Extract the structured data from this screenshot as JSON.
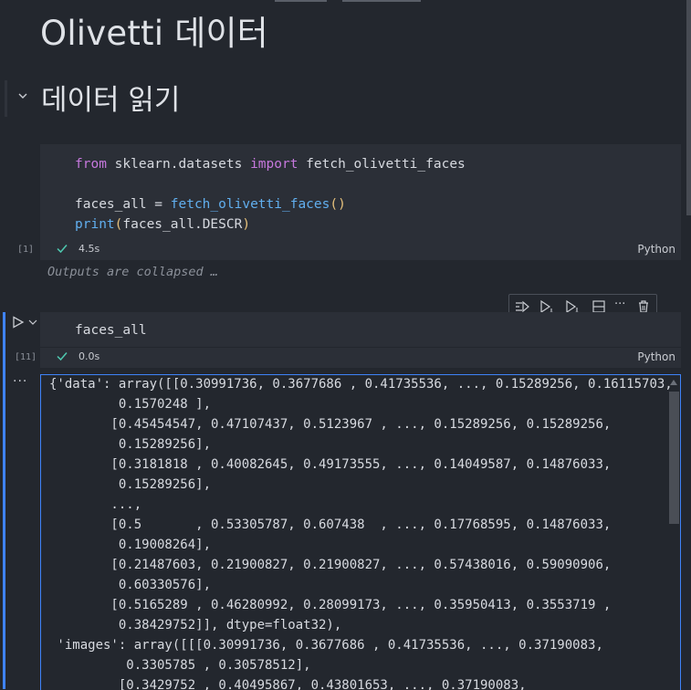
{
  "notebook": {
    "title": "Olivetti 데이터",
    "section_heading": "데이터 읽기"
  },
  "cell1": {
    "lines": [
      {
        "segments": [
          {
            "t": "from",
            "c": "kw"
          },
          {
            "t": " sklearn.datasets ",
            "c": ""
          },
          {
            "t": "import",
            "c": "kw"
          },
          {
            "t": " fetch_olivetti_faces",
            "c": ""
          }
        ]
      },
      {
        "segments": []
      },
      {
        "segments": [
          {
            "t": "faces_all = ",
            "c": ""
          },
          {
            "t": "fetch_olivetti_faces",
            "c": "fn"
          },
          {
            "t": "()",
            "c": "paren"
          }
        ]
      },
      {
        "segments": [
          {
            "t": "print",
            "c": "fn"
          },
          {
            "t": "(",
            "c": "paren"
          },
          {
            "t": "faces_all.DESCR",
            "c": ""
          },
          {
            "t": ")",
            "c": "paren"
          }
        ]
      }
    ],
    "exec_count": "[1]",
    "duration": "4.5s",
    "language": "Python",
    "collapsed_text": "Outputs are collapsed …"
  },
  "cell2": {
    "code": "faces_all",
    "exec_count": "[11]",
    "duration": "0.0s",
    "language": "Python",
    "more_label": "···"
  },
  "toolbar": {
    "more_label": "···"
  },
  "output": {
    "lines": [
      "{'data': array([[0.30991736, 0.3677686 , 0.41735536, ..., 0.15289256, 0.16115703,",
      "         0.1570248 ],",
      "        [0.45454547, 0.47107437, 0.5123967 , ..., 0.15289256, 0.15289256,",
      "         0.15289256],",
      "        [0.3181818 , 0.40082645, 0.49173555, ..., 0.14049587, 0.14876033,",
      "         0.15289256],",
      "        ...,",
      "        [0.5       , 0.53305787, 0.607438  , ..., 0.17768595, 0.14876033,",
      "         0.19008264],",
      "        [0.21487603, 0.21900827, 0.21900827, ..., 0.57438016, 0.59090906,",
      "         0.60330576],",
      "        [0.5165289 , 0.46280992, 0.28099173, ..., 0.35950413, 0.3553719 ,",
      "         0.38429752]], dtype=float32),",
      " 'images': array([[[0.30991736, 0.3677686 , 0.41735536, ..., 0.37190083,",
      "          0.3305785 , 0.30578512],",
      "         [0.3429752 , 0.40495867, 0.43801653, ..., 0.37190083,"
    ]
  },
  "colors": {
    "background": "#23272e",
    "cell_background": "#2b2f37",
    "accent": "#3f83f8",
    "keyword": "#c678dd",
    "function": "#61afef",
    "bracket": "#e5c07b",
    "success": "#4ec9b0"
  }
}
